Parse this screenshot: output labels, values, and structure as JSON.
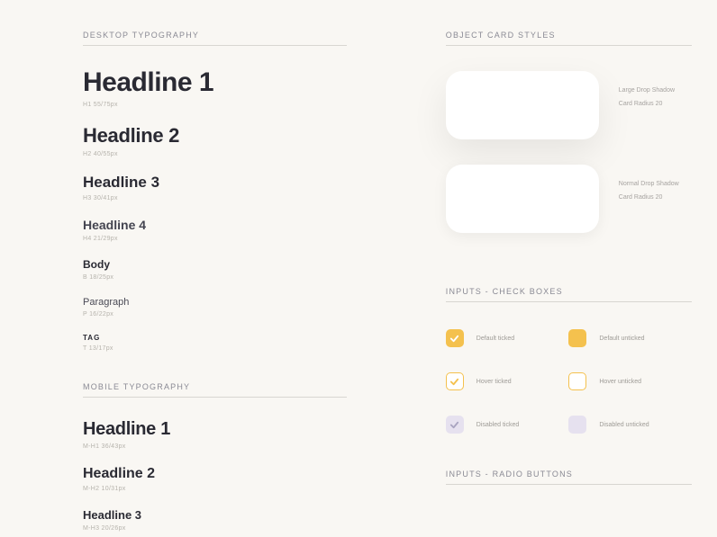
{
  "left": {
    "desktop": {
      "title": "DESKTOP TYPOGRAPHY",
      "items": [
        {
          "label": "Headline 1",
          "sub": "H1 55/75px"
        },
        {
          "label": "Headline 2",
          "sub": "H2 40/55px"
        },
        {
          "label": "Headline 3",
          "sub": "H3 30/41px"
        },
        {
          "label": "Headline 4",
          "sub": "H4 21/29px"
        },
        {
          "label": "Body",
          "sub": "B 18/25px"
        },
        {
          "label": "Paragraph",
          "sub": "P 16/22px"
        },
        {
          "label": "TAG",
          "sub": "T 13/17px"
        }
      ]
    },
    "mobile": {
      "title": "MOBILE TYPOGRAPHY",
      "items": [
        {
          "label": "Headline 1",
          "sub": "M-H1 36/43px"
        },
        {
          "label": "Headline 2",
          "sub": "M-H2 10/31px"
        },
        {
          "label": "Headline 3",
          "sub": "M-H3 20/26px"
        }
      ]
    }
  },
  "right": {
    "cards": {
      "title": "OBJECT CARD STYLES",
      "items": [
        {
          "l1": "Large Drop Shadow",
          "l2": "Card Radius 20"
        },
        {
          "l1": "Normal Drop Shadow",
          "l2": "Card Radius 20"
        }
      ]
    },
    "checks": {
      "title": "INPUTS - CHECK BOXES",
      "items": [
        {
          "label": "Default ticked"
        },
        {
          "label": "Default unticked"
        },
        {
          "label": "Hover ticked"
        },
        {
          "label": "Hover unticked"
        },
        {
          "label": "Disabled ticked"
        },
        {
          "label": "Disabled unticked"
        }
      ]
    },
    "radios": {
      "title": "INPUTS - RADIO BUTTONS"
    }
  }
}
